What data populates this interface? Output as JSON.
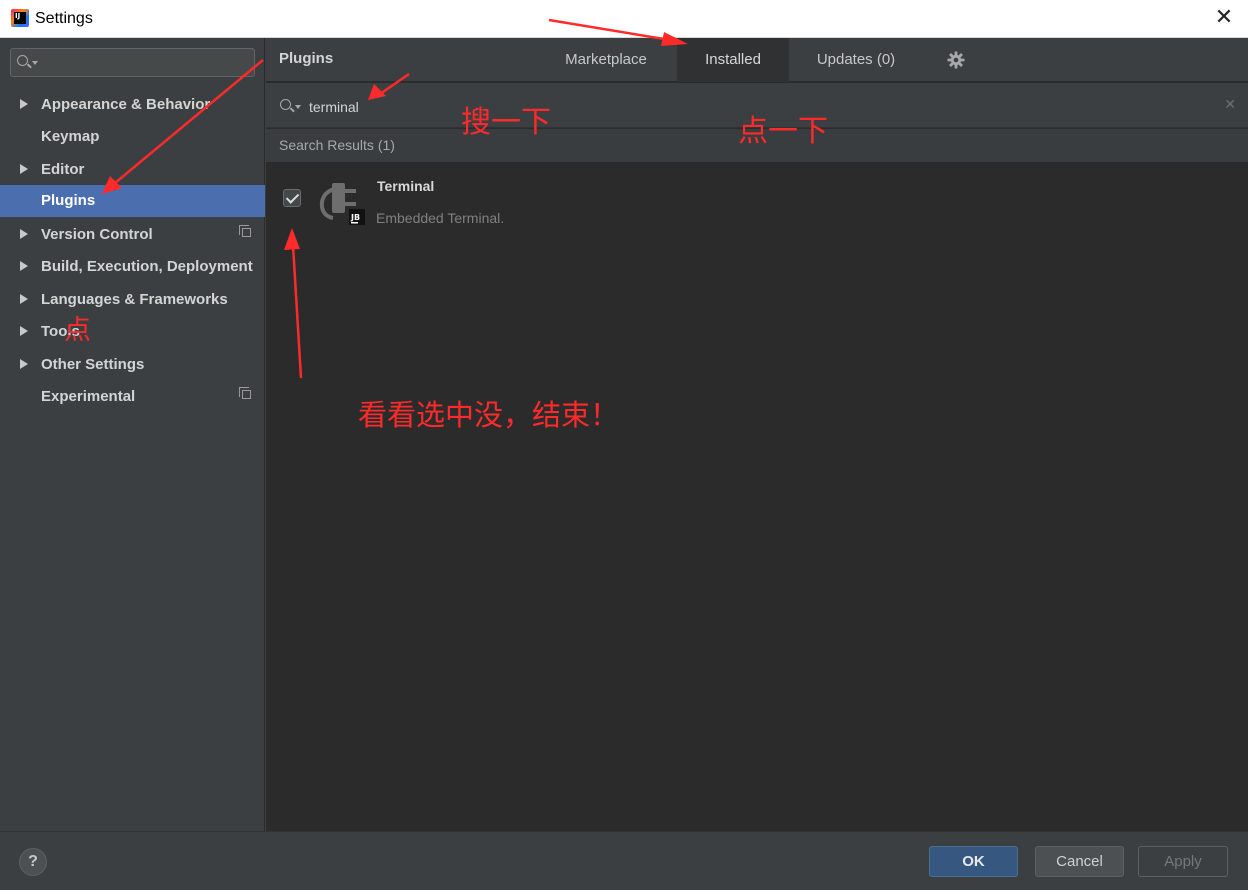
{
  "window": {
    "title": "Settings",
    "close_glyph": "✕"
  },
  "sidebar": {
    "search_placeholder": "",
    "items": [
      {
        "label": "Appearance & Behavior",
        "expandable": true,
        "copy_icon": false,
        "selected": false
      },
      {
        "label": "Keymap",
        "expandable": false,
        "copy_icon": false,
        "selected": false
      },
      {
        "label": "Editor",
        "expandable": true,
        "copy_icon": false,
        "selected": false
      },
      {
        "label": "Plugins",
        "expandable": false,
        "copy_icon": false,
        "selected": true
      },
      {
        "label": "Version Control",
        "expandable": true,
        "copy_icon": true,
        "selected": false
      },
      {
        "label": "Build, Execution, Deployment",
        "expandable": true,
        "copy_icon": false,
        "selected": false
      },
      {
        "label": "Languages & Frameworks",
        "expandable": true,
        "copy_icon": false,
        "selected": false
      },
      {
        "label": "Tools",
        "expandable": true,
        "copy_icon": false,
        "selected": false
      },
      {
        "label": "Other Settings",
        "expandable": true,
        "copy_icon": false,
        "selected": false
      },
      {
        "label": "Experimental",
        "expandable": false,
        "copy_icon": true,
        "selected": false
      }
    ]
  },
  "plugins": {
    "title": "Plugins",
    "tabs": [
      {
        "label": "Marketplace",
        "active": false
      },
      {
        "label": "Installed",
        "active": true
      },
      {
        "label": "Updates (0)",
        "active": false
      }
    ],
    "search_value": "terminal",
    "clear_glyph": "✕",
    "results_label": "Search Results (1)",
    "results": [
      {
        "name": "Terminal",
        "description": "Embedded Terminal.",
        "checked": true,
        "badge": "JB"
      }
    ]
  },
  "footer": {
    "help_label": "?",
    "ok_label": "OK",
    "cancel_label": "Cancel",
    "apply_label": "Apply"
  },
  "annotations": {
    "search_note": "搜一下",
    "click_tab_note": "点一下",
    "click_plugins_note": "点",
    "check_note": "看看选中没，结束！"
  },
  "colors": {
    "accent": "#4b6eaf",
    "annotation": "#ff2a2a",
    "ok_button": "#365880",
    "background": "#2b2b2b"
  }
}
